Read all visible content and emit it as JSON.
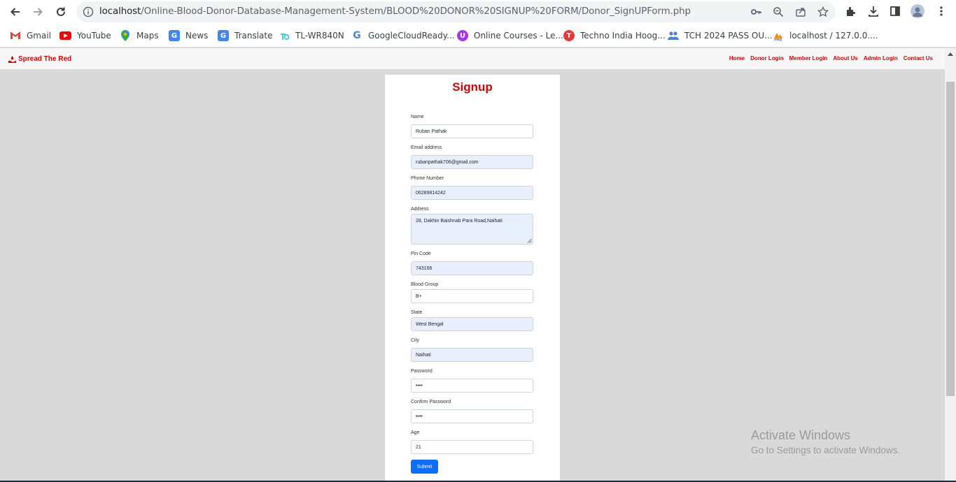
{
  "browser": {
    "url_host": "localhost",
    "url_path": "/Online-Blood-Donor-Database-Management-System/BLOOD%20DONOR%20SIGNUP%20FORM/Donor_SignUPForm.php",
    "bookmarks": [
      {
        "label": "Gmail",
        "icon": "gmail-icon"
      },
      {
        "label": "YouTube",
        "icon": "youtube-icon"
      },
      {
        "label": "Maps",
        "icon": "maps-icon"
      },
      {
        "label": "News",
        "icon": "news-icon"
      },
      {
        "label": "Translate",
        "icon": "translate-icon"
      },
      {
        "label": "TL-WR840N",
        "icon": "tplink-icon"
      },
      {
        "label": "GoogleCloudReady...",
        "icon": "google-icon"
      },
      {
        "label": "Online Courses - Le...",
        "icon": "courses-icon"
      },
      {
        "label": "Techno India Hoog...",
        "icon": "techno-icon"
      },
      {
        "label": "TCH 2024 PASS OU...",
        "icon": "group-icon"
      },
      {
        "label": "localhost / 127.0.0....",
        "icon": "phpmyadmin-icon"
      }
    ]
  },
  "site": {
    "brand": "Spread The Red",
    "nav": [
      "Home",
      "Donor Login",
      "Member Login",
      "About Us",
      "Admin Login",
      "Contact Us"
    ]
  },
  "form": {
    "title": "Signup",
    "fields": [
      {
        "label": "Name",
        "value": "Ruban Pathak"
      },
      {
        "label": "Email address",
        "value": "rubanpathak706@gmail.com"
      },
      {
        "label": "Phone Number",
        "value": "06289814242"
      },
      {
        "label": "Address",
        "value": "28, Dakhin Baishnab Para Road,Naihati"
      },
      {
        "label": "Pin Code",
        "value": "743166"
      },
      {
        "label": "Blood Group",
        "value": "B+"
      },
      {
        "label": "State",
        "value": "West Bengal"
      },
      {
        "label": "City",
        "value": "Naihati"
      },
      {
        "label": "Password",
        "value": "••••"
      },
      {
        "label": "Confirm Password",
        "value": "••••"
      },
      {
        "label": "Age",
        "value": "21"
      }
    ],
    "submit_label": "Submit"
  },
  "watermark": {
    "line1": "Activate Windows",
    "line2": "Go to Settings to activate Windows."
  },
  "colors": {
    "accent": "#e00000",
    "button": "#0d6efd",
    "autofill": "#e8f0fe"
  }
}
